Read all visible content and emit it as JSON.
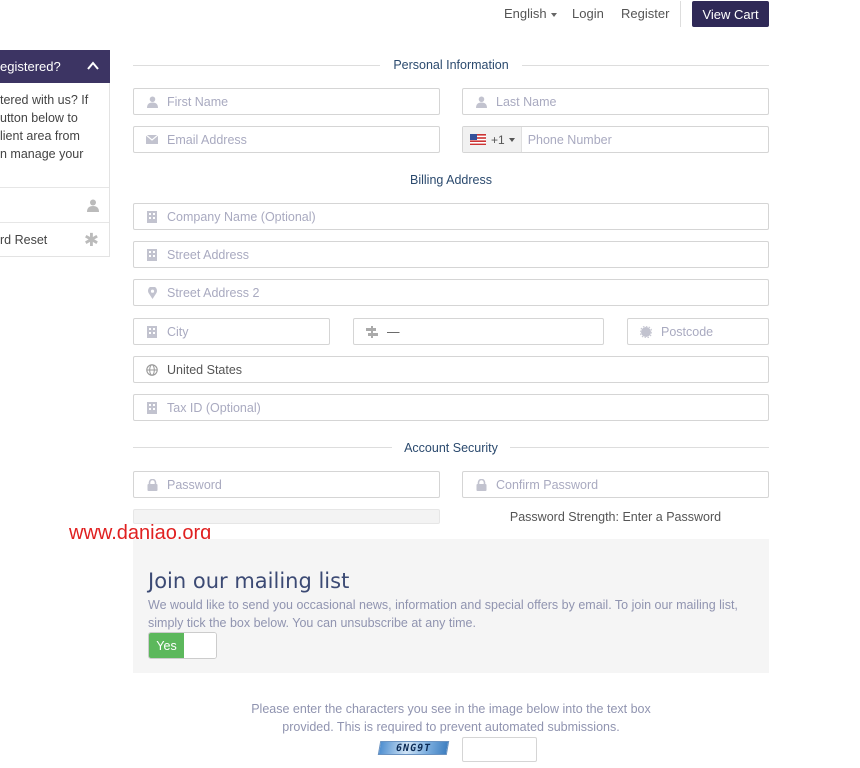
{
  "topnav": {
    "language": "English",
    "login": "Login",
    "register": "Register",
    "view_cart": "View Cart"
  },
  "sidebar": {
    "header": "egistered?",
    "body_lines": [
      "tered with us? If",
      "utton below to",
      "lient area from",
      "n manage your"
    ],
    "items": [
      {
        "label": "",
        "icon": "user-icon"
      },
      {
        "label": "rd Reset",
        "icon": "asterisk-icon"
      }
    ]
  },
  "sections": {
    "personal": "Personal Information",
    "billing": "Billing Address",
    "security": "Account Security"
  },
  "fields": {
    "first_name": "First Name",
    "last_name": "Last Name",
    "email": "Email Address",
    "phone_code": "+1",
    "phone": "Phone Number",
    "company": "Company Name (Optional)",
    "street": "Street Address",
    "street2": "Street Address 2",
    "city": "City",
    "state": "—",
    "postcode": "Postcode",
    "country": "United States",
    "tax_id": "Tax ID (Optional)",
    "password": "Password",
    "confirm_password": "Confirm Password"
  },
  "password_strength": "Password Strength: Enter a Password",
  "watermark": "www.daniao.org",
  "mailing": {
    "title": "Join our mailing list",
    "text_line1": "We would like to send you occasional news, information and special offers by email. To join our mailing list,",
    "text_line2": "simply tick the box below. You can unsubscribe at any time.",
    "toggle_label": "Yes"
  },
  "captcha": {
    "line1": "Please enter the characters you see in the image below into the text box",
    "line2": "provided. This is required to prevent automated submissions.",
    "code": "6NG9T"
  },
  "colors": {
    "primary": "#2f2957",
    "sidebar_header": "#3c3463",
    "section_title": "#2b4a6e",
    "toggle_on": "#5cb85c",
    "watermark": "#e02020"
  }
}
